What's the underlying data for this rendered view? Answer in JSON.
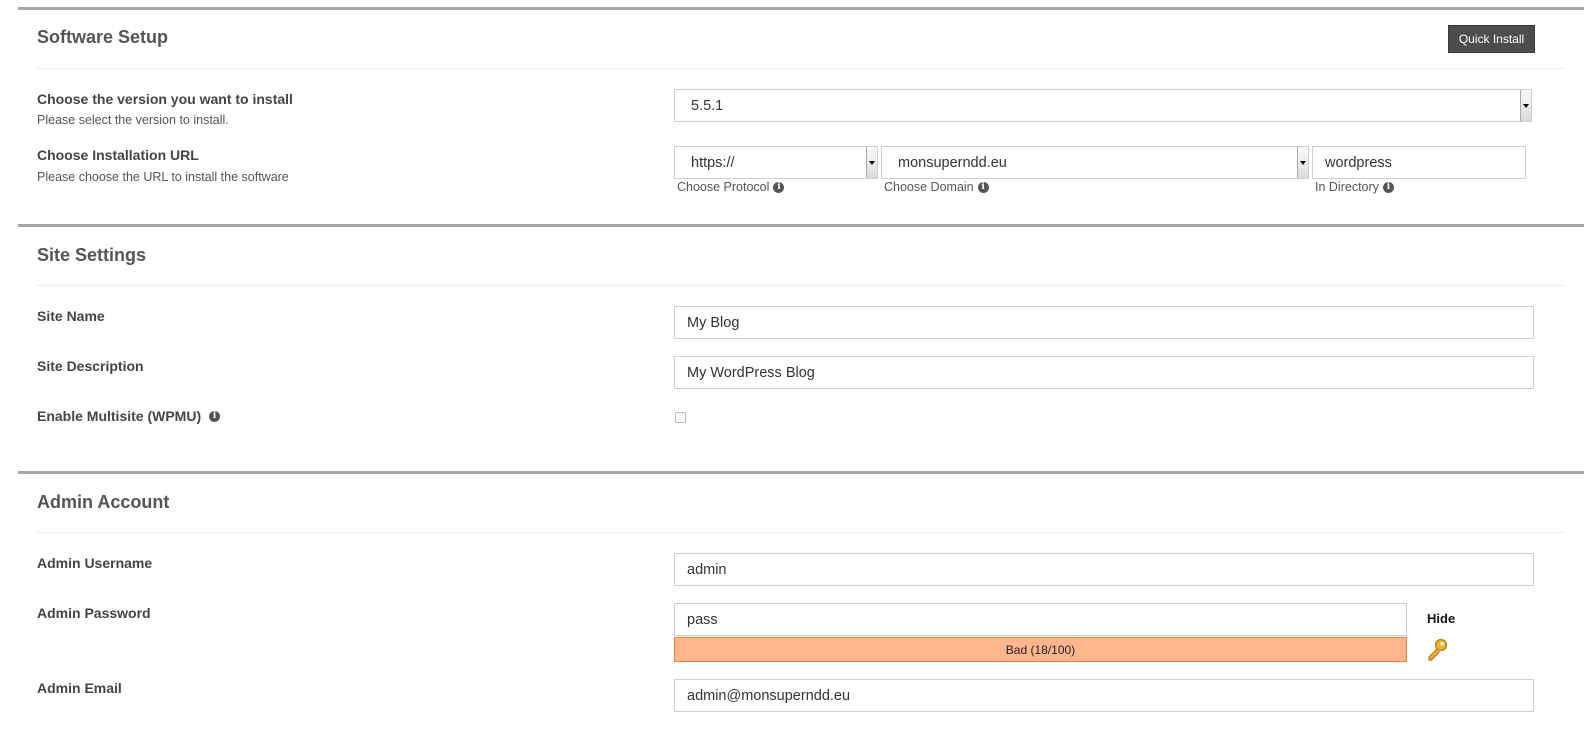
{
  "software_setup": {
    "title": "Software Setup",
    "quick_install_label": "Quick Install",
    "version": {
      "label": "Choose the version you want to install",
      "sublabel": "Please select the version to install.",
      "value": "5.5.1"
    },
    "install_url": {
      "label": "Choose Installation URL",
      "sublabel": "Please choose the URL to install the software",
      "protocol_value": "https://",
      "protocol_hint": "Choose Protocol",
      "domain_value": "monsuperndd.eu",
      "domain_hint": "Choose Domain",
      "directory_value": "wordpress",
      "directory_hint": "In Directory"
    }
  },
  "site_settings": {
    "title": "Site Settings",
    "site_name_label": "Site Name",
    "site_name_value": "My Blog",
    "site_description_label": "Site Description",
    "site_description_value": "My WordPress Blog",
    "multisite_label": "Enable Multisite (WPMU)",
    "multisite_checked": false
  },
  "admin_account": {
    "title": "Admin Account",
    "username_label": "Admin Username",
    "username_value": "admin",
    "password_label": "Admin Password",
    "password_value": "pass",
    "password_strength_text": "Bad (18/100)",
    "password_strength_score": 18,
    "hide_label": "Hide",
    "email_label": "Admin Email",
    "email_value": "admin@monsuperndd.eu"
  },
  "colors": {
    "section_bar": "#a7a7a7",
    "quick_install_bg": "#4d4d4d",
    "strength_bad": "#ffb68c"
  },
  "icons": {
    "info": "info-circle-icon",
    "password_generate": "key-icon",
    "select_arrow": "chevron-down-icon"
  }
}
